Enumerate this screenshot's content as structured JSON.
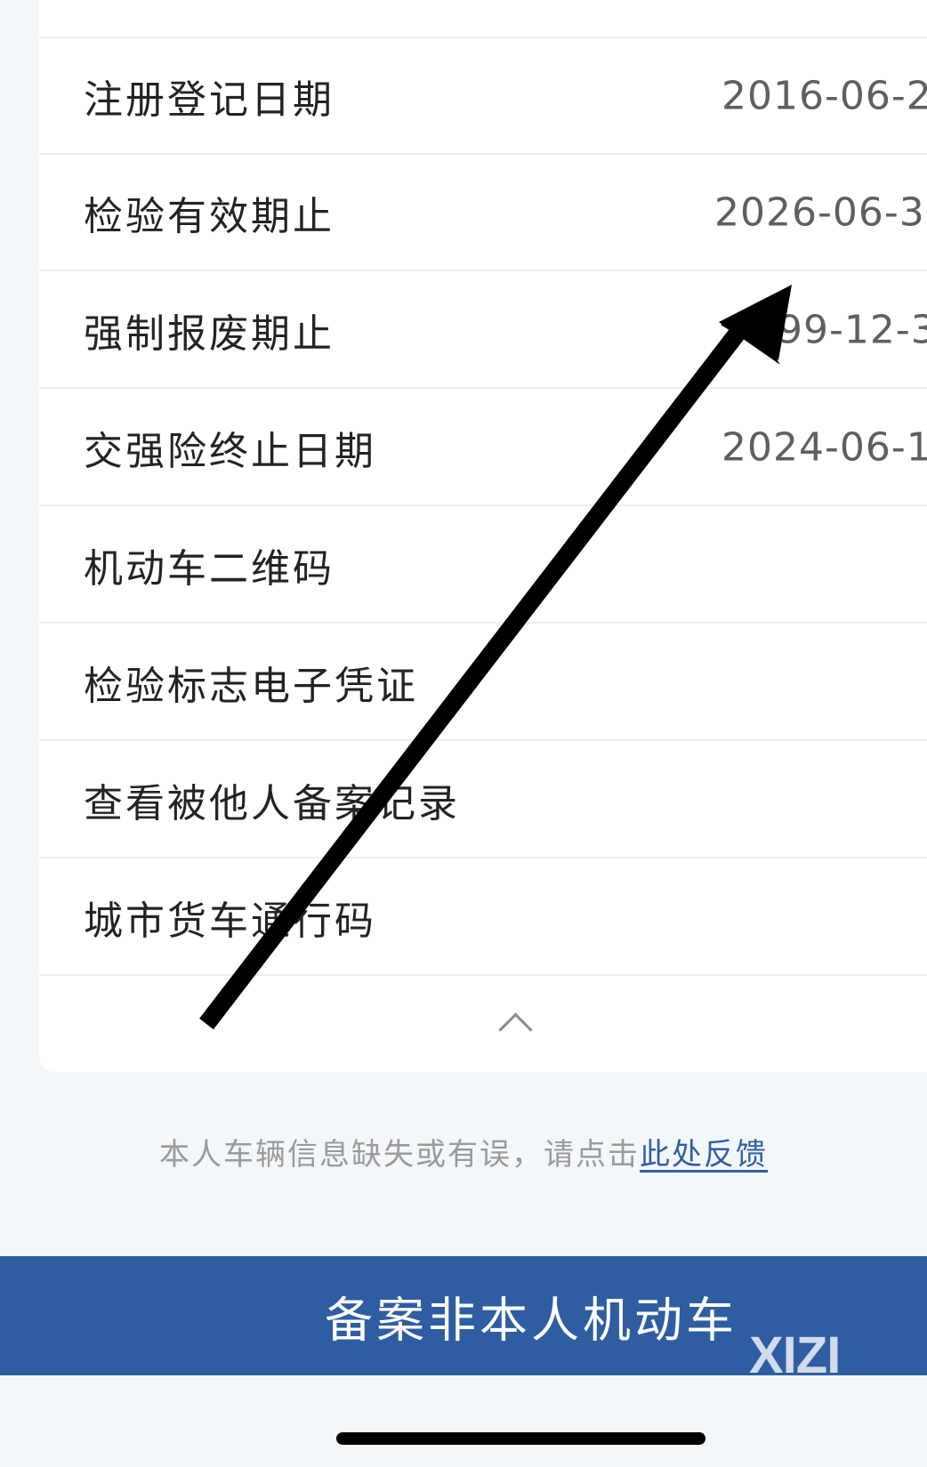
{
  "vehicle_info": {
    "rows": [
      {
        "label": "注册登记日期",
        "value": "2016-06-2"
      },
      {
        "label": "检验有效期止",
        "value": "2026-06-3"
      },
      {
        "label": "强制报废期止",
        "value": "99-12-3"
      },
      {
        "label": "交强险终止日期",
        "value": "2024-06-1"
      },
      {
        "label": "机动车二维码",
        "value": ""
      },
      {
        "label": "检验标志电子凭证",
        "value": ""
      },
      {
        "label": "查看被他人备案记录",
        "value": ""
      },
      {
        "label": "城市货车通行码",
        "value": ""
      }
    ]
  },
  "collapse": {
    "icon": "chevron-up-icon"
  },
  "feedback": {
    "text": "本人车辆信息缺失或有误，请点击",
    "link": "此处反馈"
  },
  "primary_action": {
    "label": "备案非本人机动车"
  },
  "watermark": {
    "text": "XIZI"
  },
  "colors": {
    "primary": "#2e5ea1",
    "link": "#2f5fa6",
    "background": "#f4f7fa",
    "annotation_arrow": "#000000"
  }
}
